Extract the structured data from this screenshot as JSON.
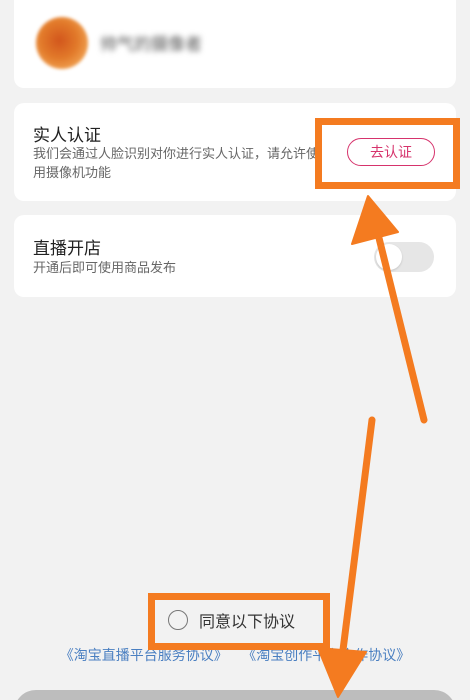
{
  "profile": {
    "username": "帅气的摄像者"
  },
  "verification": {
    "title": "实人认证",
    "description": "我们会通过人脸识别对你进行实人认证，请允许使用摄像机功能",
    "button_label": "去认证"
  },
  "live_store": {
    "title": "直播开店",
    "description": "开通后即可使用商品发布",
    "toggle_on": false
  },
  "agreement": {
    "checkbox_label": "同意以下协议",
    "checked": false,
    "links": [
      "《淘宝直播平台服务协议》",
      "《淘宝创作平台合作协议》"
    ]
  },
  "colors": {
    "accent": "#d6336c",
    "annotation": "#f47b20",
    "link": "#4a7fc1"
  }
}
